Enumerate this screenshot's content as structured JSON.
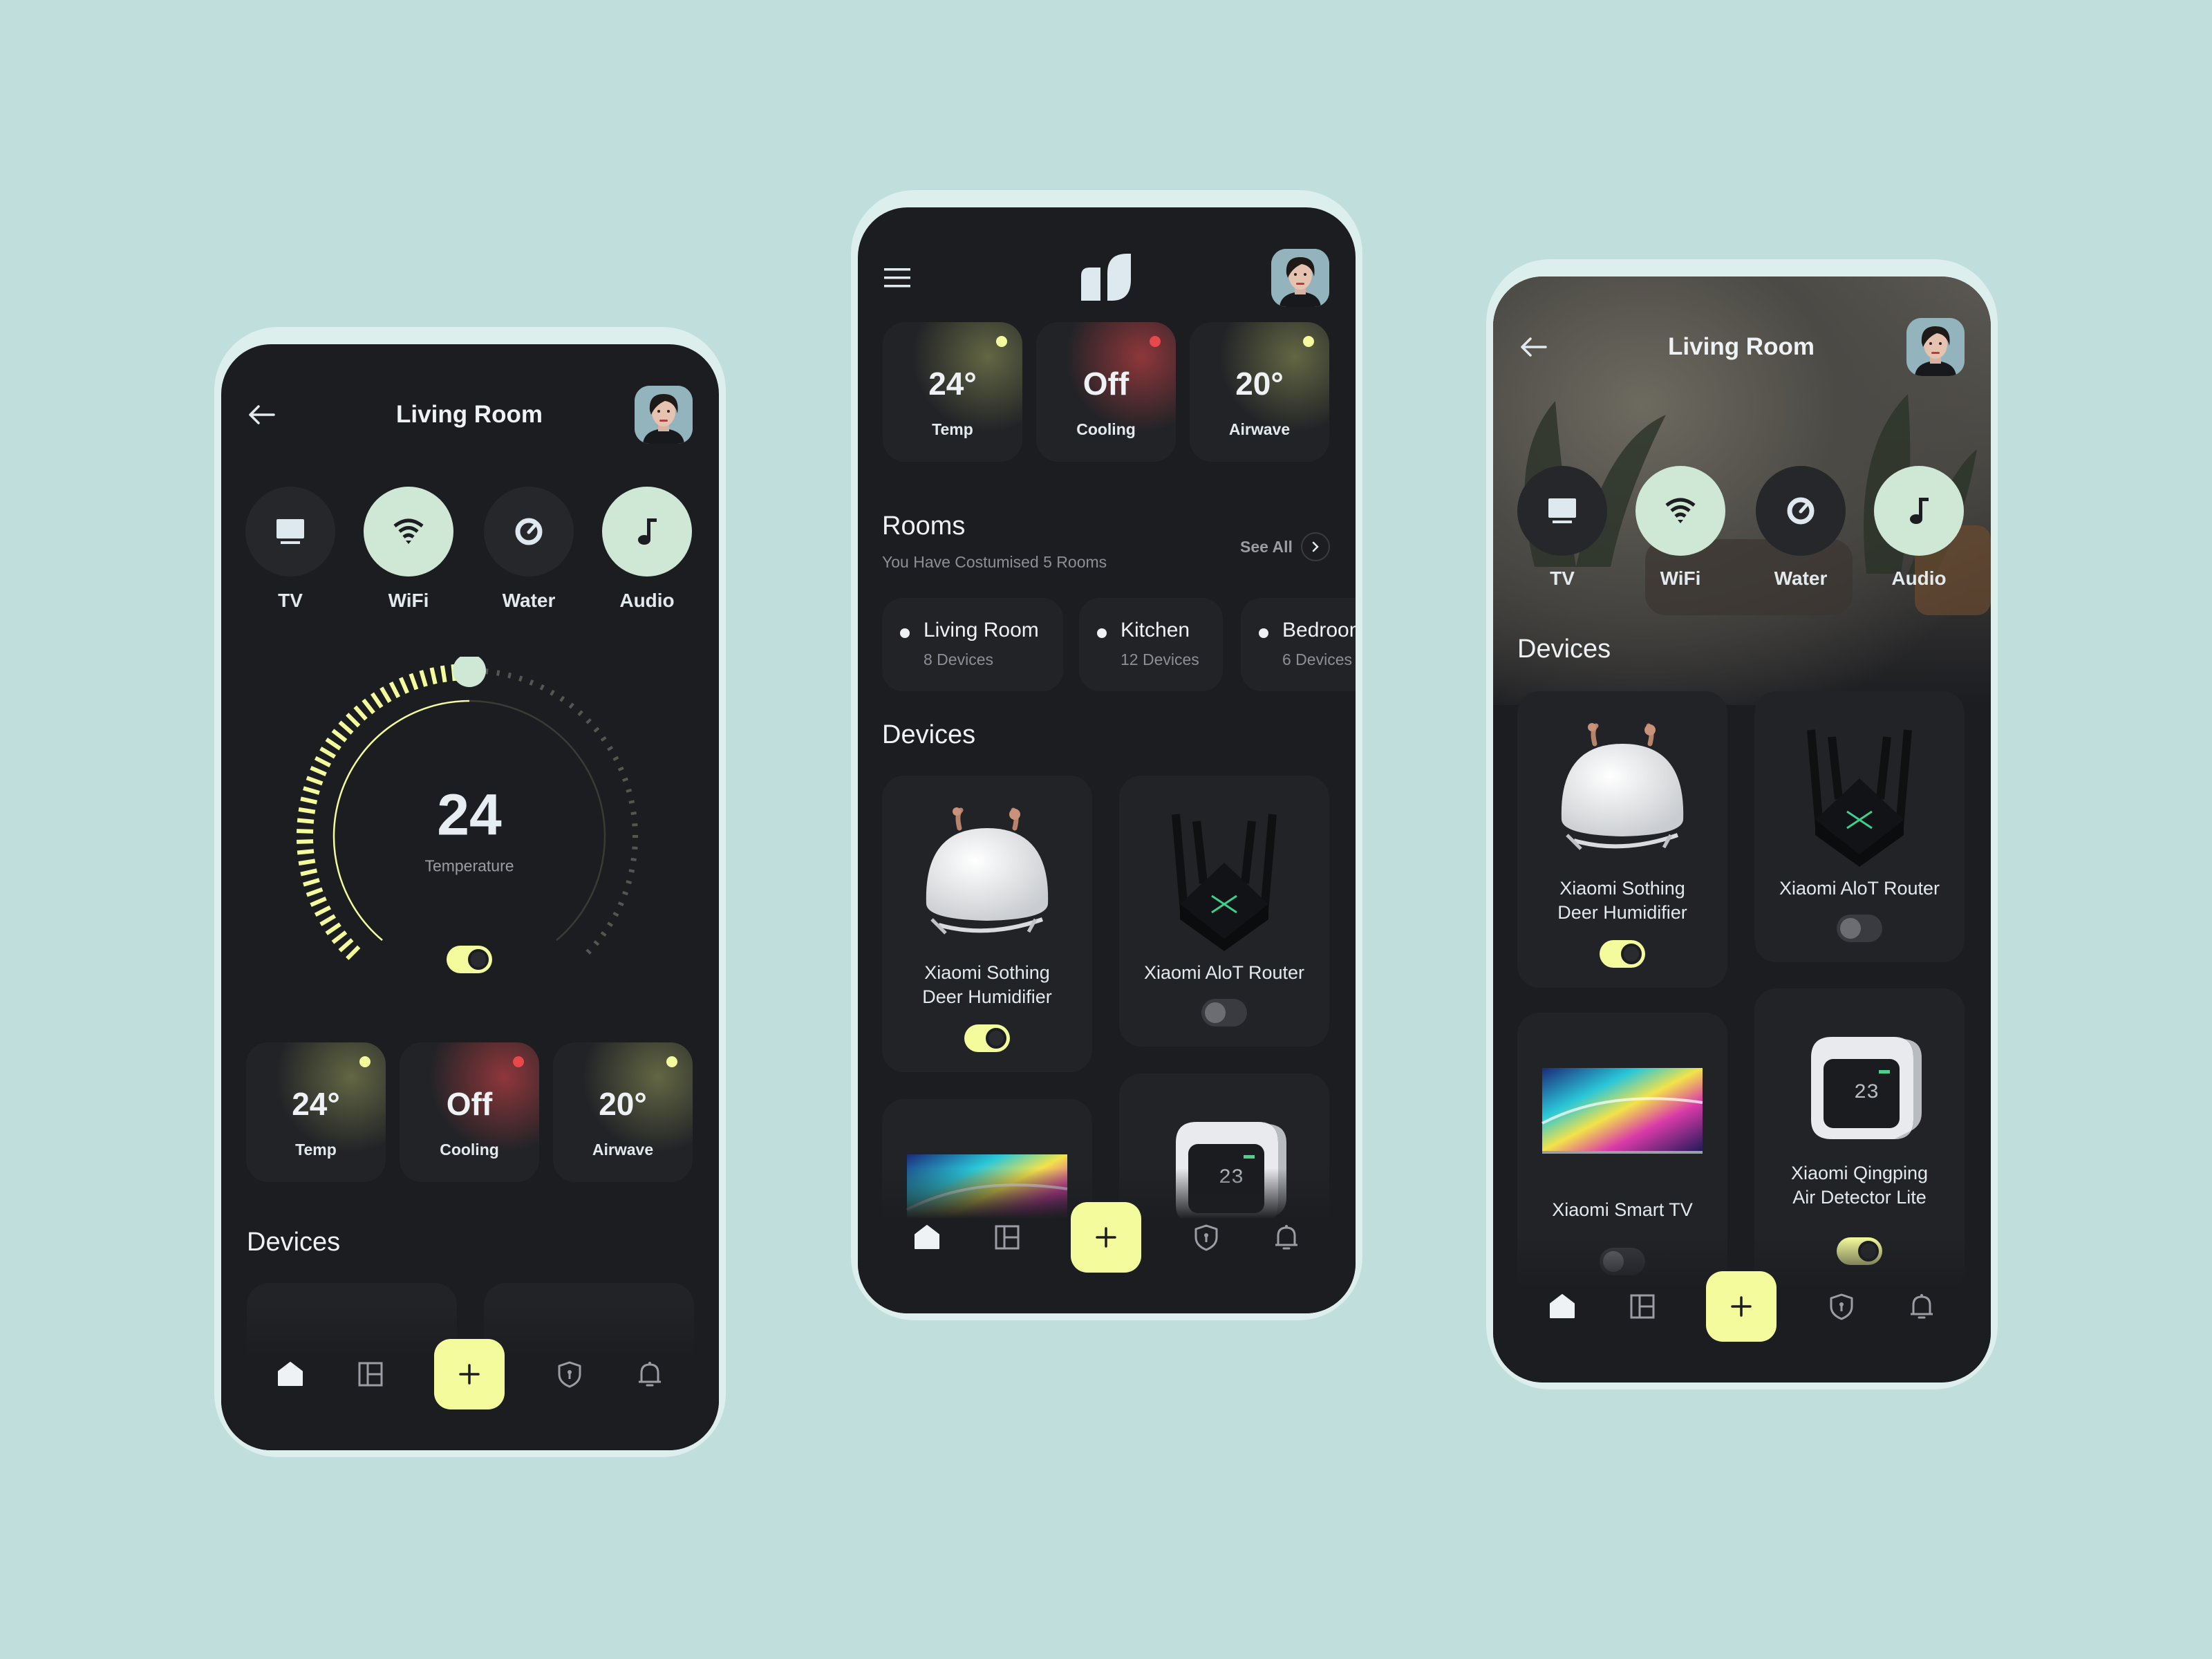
{
  "colors": {
    "background": "#c0dfdc",
    "panel": "#1c1d21",
    "card": "#222327",
    "accent_yellow": "#f4fb9c",
    "accent_mint": "#cfe8d6",
    "status_red": "#e8474b"
  },
  "phone_left": {
    "title": "Living Room",
    "quick": [
      {
        "label": "TV",
        "icon": "tv-icon",
        "active": false
      },
      {
        "label": "WiFi",
        "icon": "wifi-icon",
        "active": true
      },
      {
        "label": "Water",
        "icon": "gauge-icon",
        "active": false
      },
      {
        "label": "Audio",
        "icon": "music-note-icon",
        "active": true
      }
    ],
    "thermostat": {
      "value": "24",
      "label": "Temperature",
      "level": 0.5,
      "on": true
    },
    "stats": [
      {
        "value": "24°",
        "label": "Temp",
        "status": "yellow"
      },
      {
        "value": "Off",
        "label": "Cooling",
        "status": "red"
      },
      {
        "value": "20°",
        "label": "Airwave",
        "status": "yellow"
      }
    ],
    "devices_heading": "Devices"
  },
  "phone_middle": {
    "stats": [
      {
        "value": "24°",
        "label": "Temp",
        "status": "yellow"
      },
      {
        "value": "Off",
        "label": "Cooling",
        "status": "red"
      },
      {
        "value": "20°",
        "label": "Airwave",
        "status": "yellow"
      }
    ],
    "rooms": {
      "title": "Rooms",
      "subtitle": "You Have Costumised 5 Rooms",
      "see_all": "See All",
      "items": [
        {
          "name": "Living Room",
          "count": "8 Devices"
        },
        {
          "name": "Kitchen",
          "count": "12 Devices"
        },
        {
          "name": "Bedroom",
          "count": "6 Devices"
        }
      ]
    },
    "devices_heading": "Devices",
    "devices": [
      {
        "name": "Xiaomi Sothing\nDeer Humidifier",
        "image": "humidifier",
        "on": true
      },
      {
        "name": "Xiaomi AloT Router",
        "image": "router",
        "on": false
      },
      {
        "name": "",
        "image": "tv",
        "on": false
      },
      {
        "name": "",
        "image": "air-detector",
        "on": true
      }
    ]
  },
  "phone_right": {
    "title": "Living Room",
    "quick": [
      {
        "label": "TV",
        "icon": "tv-icon",
        "active": false
      },
      {
        "label": "WiFi",
        "icon": "wifi-icon",
        "active": true
      },
      {
        "label": "Water",
        "icon": "gauge-icon",
        "active": false
      },
      {
        "label": "Audio",
        "icon": "music-note-icon",
        "active": true
      }
    ],
    "devices_heading": "Devices",
    "devices": [
      {
        "name": "Xiaomi Sothing\nDeer Humidifier",
        "image": "humidifier",
        "on": true
      },
      {
        "name": "Xiaomi AloT Router",
        "image": "router",
        "on": false
      },
      {
        "name": "Xiaomi Smart TV",
        "image": "tv",
        "on": false
      },
      {
        "name": "Xiaomi Qingping\nAir Detector Lite",
        "image": "air-detector",
        "on": true
      }
    ]
  },
  "nav": {
    "items": [
      "home-icon",
      "rooms-icon",
      "add-icon",
      "shield-icon",
      "bell-icon"
    ],
    "active": "home-icon"
  }
}
